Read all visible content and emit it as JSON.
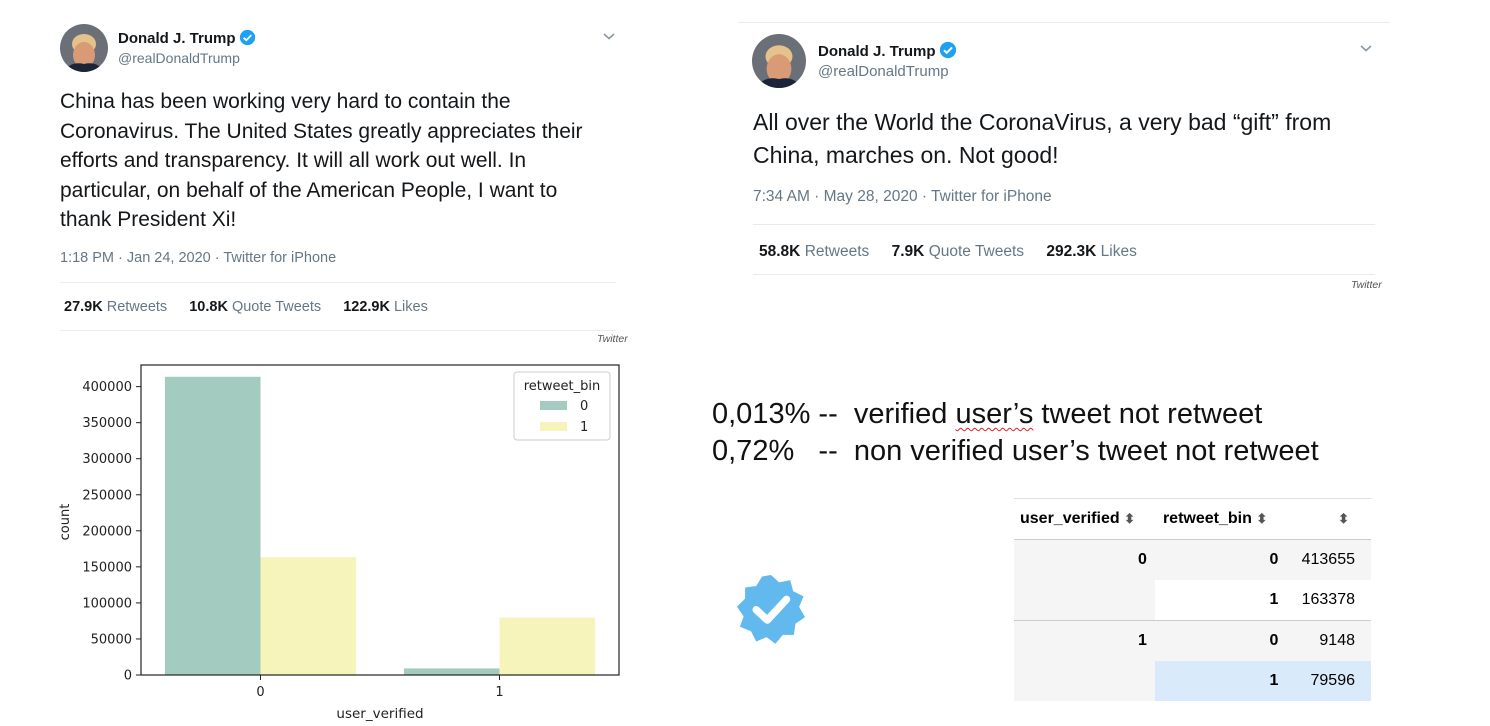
{
  "tweet1": {
    "name": "Donald J. Trump",
    "handle": "@realDonaldTrump",
    "text_lines": [
      "China has been working very hard to contain the",
      "Coronavirus. The United States greatly appreciates their",
      "efforts and transparency. It will all work out well. In",
      "particular, on behalf of the American People, I want to",
      "thank President Xi!"
    ],
    "meta": "1:18 PM · Jan 24, 2020 · Twitter for iPhone",
    "retweets": "27.9K",
    "retweets_label": "Retweets",
    "quotes": "10.8K",
    "quotes_label": "Quote Tweets",
    "likes": "122.9K",
    "likes_label": "Likes",
    "source": "Twitter"
  },
  "tweet2": {
    "name": "Donald J. Trump",
    "handle": "@realDonaldTrump",
    "text_lines": [
      "All over the World the CoronaVirus, a very bad “gift” from",
      "China, marches on. Not good!"
    ],
    "meta": "7:34 AM · May 28, 2020 · Twitter for iPhone",
    "retweets": "58.8K",
    "retweets_label": "Retweets",
    "quotes": "7.9K",
    "quotes_label": "Quote Tweets",
    "likes": "292.3K",
    "likes_label": "Likes",
    "source": "Twitter"
  },
  "annotation": {
    "line1_pct": "0,013%",
    "line1_sep": "--",
    "line1_pre": "verified",
    "line1_word": "user’s",
    "line1_post": "tweet not retweet",
    "line2_pct": "0,72%",
    "line2_sep": "--",
    "line2_text": "non verified user’s tweet not retweet"
  },
  "colors": {
    "bar_0": "#a3cbc0",
    "bar_1": "#f6f4bb",
    "verified_badge": "#62b9ee",
    "twitter_blue": "#1da1f2",
    "highlight_row": "#d9ebfb",
    "stripe": "#f5f5f5"
  },
  "table": {
    "headers": [
      "user_verified",
      "retweet_bin",
      ""
    ],
    "sort_glyph": "⬍",
    "rows": [
      {
        "user_verified": "0",
        "retweet_bin": "0",
        "count": "413655"
      },
      {
        "user_verified": "",
        "retweet_bin": "1",
        "count": "163378"
      },
      {
        "user_verified": "1",
        "retweet_bin": "0",
        "count": "9148"
      },
      {
        "user_verified": "",
        "retweet_bin": "1",
        "count": "79596"
      }
    ]
  },
  "chart_data": {
    "type": "bar",
    "categories": [
      "0",
      "1"
    ],
    "series": [
      {
        "name": "0",
        "values": [
          413655,
          9148
        ]
      },
      {
        "name": "1",
        "values": [
          163378,
          79596
        ]
      }
    ],
    "xlabel": "user_verified",
    "ylabel": "count",
    "legend_title": "retweet_bin",
    "legend_position": "top-right",
    "ylim": [
      0,
      430000
    ],
    "yticks": [
      0,
      50000,
      100000,
      150000,
      200000,
      250000,
      300000,
      350000,
      400000
    ],
    "grid": false
  }
}
